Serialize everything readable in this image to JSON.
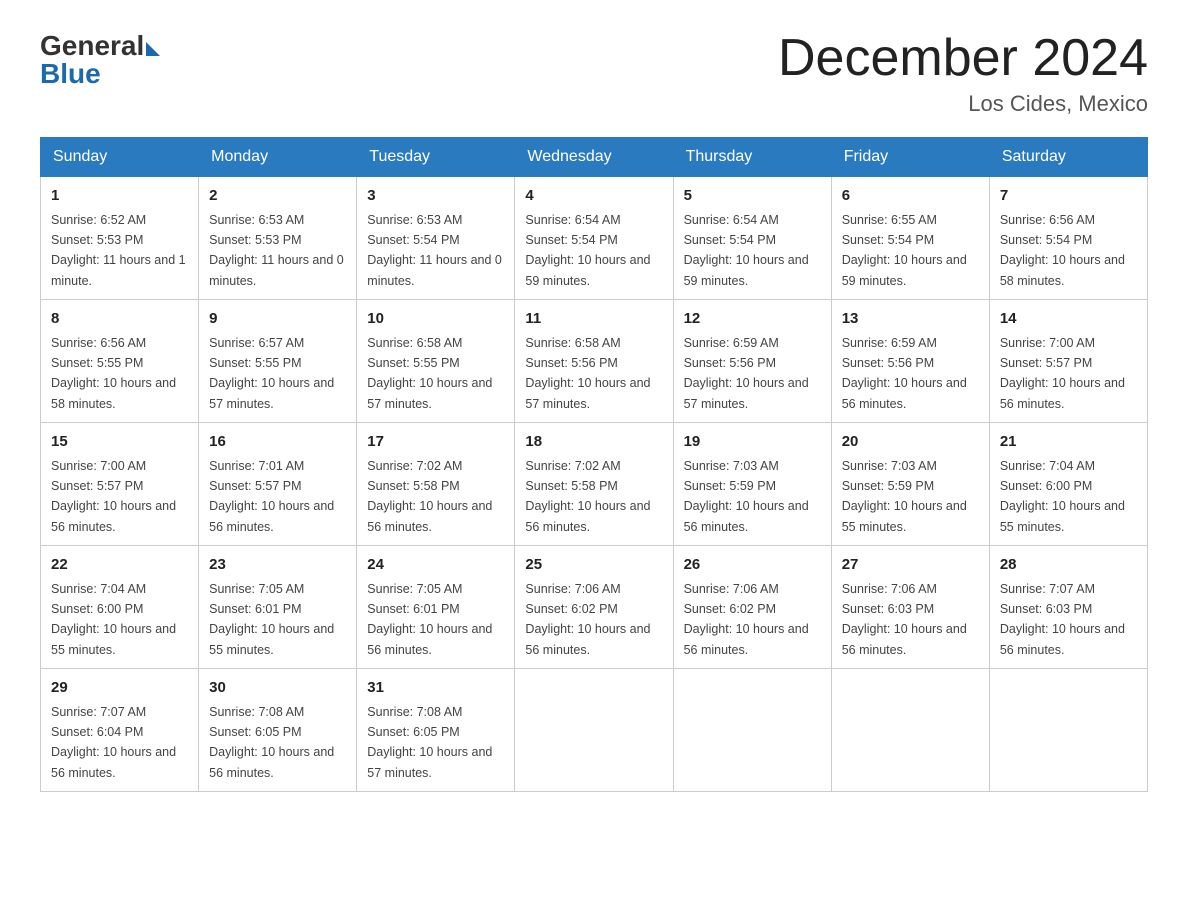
{
  "header": {
    "logo_general": "General",
    "logo_blue": "Blue",
    "month_title": "December 2024",
    "location": "Los Cides, Mexico"
  },
  "weekdays": [
    "Sunday",
    "Monday",
    "Tuesday",
    "Wednesday",
    "Thursday",
    "Friday",
    "Saturday"
  ],
  "weeks": [
    [
      {
        "day": "1",
        "sunrise": "6:52 AM",
        "sunset": "5:53 PM",
        "daylight": "11 hours and 1 minute."
      },
      {
        "day": "2",
        "sunrise": "6:53 AM",
        "sunset": "5:53 PM",
        "daylight": "11 hours and 0 minutes."
      },
      {
        "day": "3",
        "sunrise": "6:53 AM",
        "sunset": "5:54 PM",
        "daylight": "11 hours and 0 minutes."
      },
      {
        "day": "4",
        "sunrise": "6:54 AM",
        "sunset": "5:54 PM",
        "daylight": "10 hours and 59 minutes."
      },
      {
        "day": "5",
        "sunrise": "6:54 AM",
        "sunset": "5:54 PM",
        "daylight": "10 hours and 59 minutes."
      },
      {
        "day": "6",
        "sunrise": "6:55 AM",
        "sunset": "5:54 PM",
        "daylight": "10 hours and 59 minutes."
      },
      {
        "day": "7",
        "sunrise": "6:56 AM",
        "sunset": "5:54 PM",
        "daylight": "10 hours and 58 minutes."
      }
    ],
    [
      {
        "day": "8",
        "sunrise": "6:56 AM",
        "sunset": "5:55 PM",
        "daylight": "10 hours and 58 minutes."
      },
      {
        "day": "9",
        "sunrise": "6:57 AM",
        "sunset": "5:55 PM",
        "daylight": "10 hours and 57 minutes."
      },
      {
        "day": "10",
        "sunrise": "6:58 AM",
        "sunset": "5:55 PM",
        "daylight": "10 hours and 57 minutes."
      },
      {
        "day": "11",
        "sunrise": "6:58 AM",
        "sunset": "5:56 PM",
        "daylight": "10 hours and 57 minutes."
      },
      {
        "day": "12",
        "sunrise": "6:59 AM",
        "sunset": "5:56 PM",
        "daylight": "10 hours and 57 minutes."
      },
      {
        "day": "13",
        "sunrise": "6:59 AM",
        "sunset": "5:56 PM",
        "daylight": "10 hours and 56 minutes."
      },
      {
        "day": "14",
        "sunrise": "7:00 AM",
        "sunset": "5:57 PM",
        "daylight": "10 hours and 56 minutes."
      }
    ],
    [
      {
        "day": "15",
        "sunrise": "7:00 AM",
        "sunset": "5:57 PM",
        "daylight": "10 hours and 56 minutes."
      },
      {
        "day": "16",
        "sunrise": "7:01 AM",
        "sunset": "5:57 PM",
        "daylight": "10 hours and 56 minutes."
      },
      {
        "day": "17",
        "sunrise": "7:02 AM",
        "sunset": "5:58 PM",
        "daylight": "10 hours and 56 minutes."
      },
      {
        "day": "18",
        "sunrise": "7:02 AM",
        "sunset": "5:58 PM",
        "daylight": "10 hours and 56 minutes."
      },
      {
        "day": "19",
        "sunrise": "7:03 AM",
        "sunset": "5:59 PM",
        "daylight": "10 hours and 56 minutes."
      },
      {
        "day": "20",
        "sunrise": "7:03 AM",
        "sunset": "5:59 PM",
        "daylight": "10 hours and 55 minutes."
      },
      {
        "day": "21",
        "sunrise": "7:04 AM",
        "sunset": "6:00 PM",
        "daylight": "10 hours and 55 minutes."
      }
    ],
    [
      {
        "day": "22",
        "sunrise": "7:04 AM",
        "sunset": "6:00 PM",
        "daylight": "10 hours and 55 minutes."
      },
      {
        "day": "23",
        "sunrise": "7:05 AM",
        "sunset": "6:01 PM",
        "daylight": "10 hours and 55 minutes."
      },
      {
        "day": "24",
        "sunrise": "7:05 AM",
        "sunset": "6:01 PM",
        "daylight": "10 hours and 56 minutes."
      },
      {
        "day": "25",
        "sunrise": "7:06 AM",
        "sunset": "6:02 PM",
        "daylight": "10 hours and 56 minutes."
      },
      {
        "day": "26",
        "sunrise": "7:06 AM",
        "sunset": "6:02 PM",
        "daylight": "10 hours and 56 minutes."
      },
      {
        "day": "27",
        "sunrise": "7:06 AM",
        "sunset": "6:03 PM",
        "daylight": "10 hours and 56 minutes."
      },
      {
        "day": "28",
        "sunrise": "7:07 AM",
        "sunset": "6:03 PM",
        "daylight": "10 hours and 56 minutes."
      }
    ],
    [
      {
        "day": "29",
        "sunrise": "7:07 AM",
        "sunset": "6:04 PM",
        "daylight": "10 hours and 56 minutes."
      },
      {
        "day": "30",
        "sunrise": "7:08 AM",
        "sunset": "6:05 PM",
        "daylight": "10 hours and 56 minutes."
      },
      {
        "day": "31",
        "sunrise": "7:08 AM",
        "sunset": "6:05 PM",
        "daylight": "10 hours and 57 minutes."
      },
      null,
      null,
      null,
      null
    ]
  ]
}
